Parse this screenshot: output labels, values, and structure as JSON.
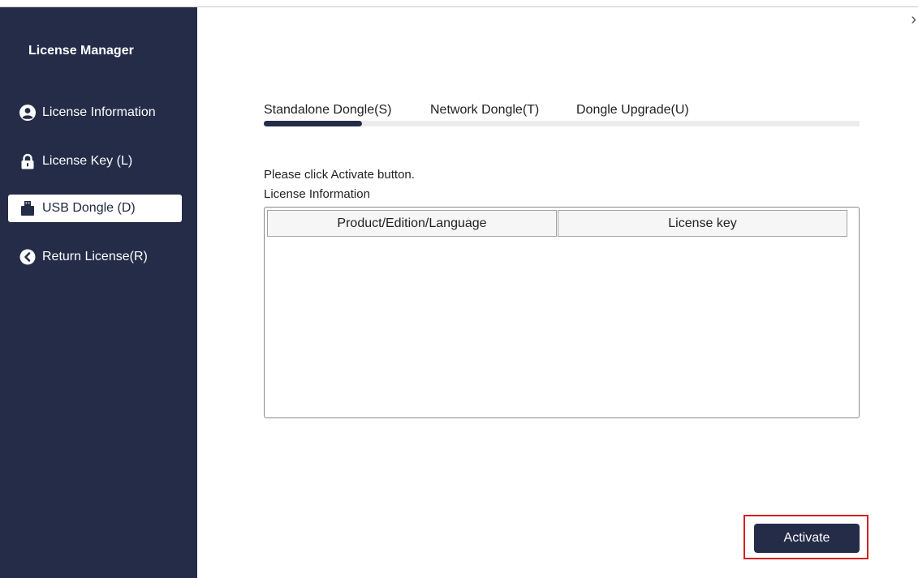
{
  "app": {
    "title": "License Manager"
  },
  "sidebar": {
    "items": [
      {
        "label": "License Information",
        "icon": "user-circle-icon",
        "active": false
      },
      {
        "label": "License Key (L)",
        "icon": "lock-icon",
        "active": false
      },
      {
        "label": "USB Dongle (D)",
        "icon": "usb-dongle-icon",
        "active": true
      },
      {
        "label": "Return License(R)",
        "icon": "back-arrow-circle-icon",
        "active": false
      }
    ]
  },
  "window": {
    "close_glyph": "›"
  },
  "tabs": [
    {
      "label": "Standalone Dongle(S)",
      "active": true
    },
    {
      "label": "Network Dongle(T)",
      "active": false
    },
    {
      "label": "Dongle Upgrade(U)",
      "active": false
    }
  ],
  "main": {
    "instruction": "Please click Activate button.",
    "section_label": "License Information",
    "table": {
      "columns": [
        "Product/Edition/Language",
        "License key"
      ],
      "rows": []
    },
    "activate_label": "Activate"
  },
  "colors": {
    "sidebar_bg": "#242c48",
    "accent": "#242c48",
    "highlight_frame": "#d42020"
  }
}
